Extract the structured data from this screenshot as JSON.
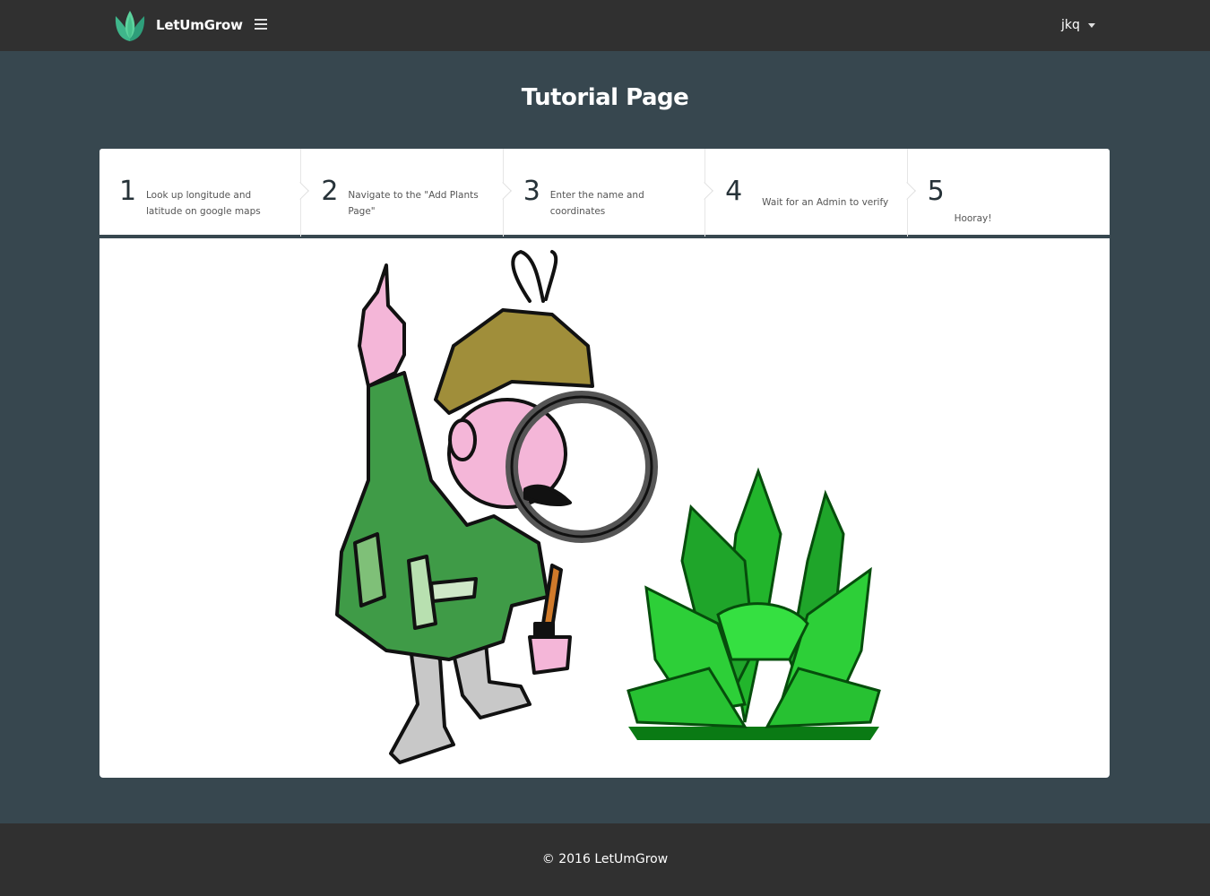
{
  "navbar": {
    "brand": "LetUmGrow",
    "user": "jkq",
    "logo_icon": "tulip-logo-icon",
    "menu_icon": "hamburger-menu-icon"
  },
  "page_title": "Tutorial Page",
  "steps": [
    {
      "number": "1",
      "text": "Look up longitude and latitude on google maps"
    },
    {
      "number": "2",
      "text": "Navigate to the \"Add Plants Page\""
    },
    {
      "number": "3",
      "text": "Enter the name and coordinates"
    },
    {
      "number": "4",
      "text": "Wait for an Admin to verify"
    },
    {
      "number": "5",
      "text": "Hooray!"
    }
  ],
  "footer": {
    "copyright": "© 2016 LetUmGrow"
  },
  "colors": {
    "navbar_bg": "#303030",
    "body_bg": "#37474f",
    "card_bg": "#ffffff",
    "brand_green": "#4caf50",
    "coat_green": "#3f9b47",
    "plant_green": "#22b52c"
  }
}
